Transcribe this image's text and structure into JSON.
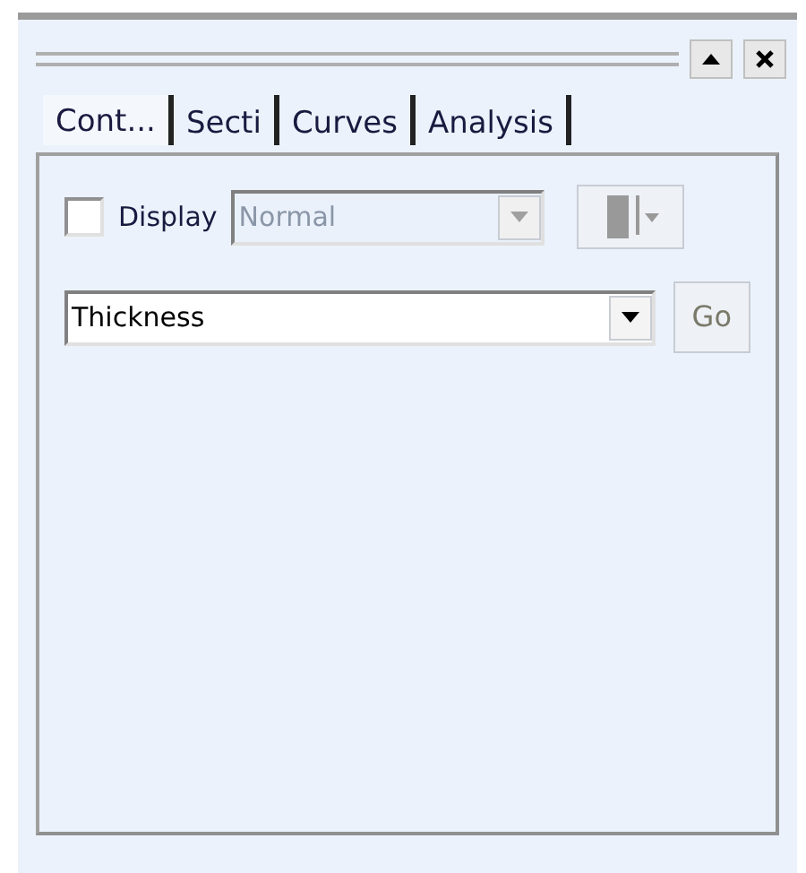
{
  "tabs": [
    {
      "label": "Cont...",
      "selected": true
    },
    {
      "label": "Secti",
      "selected": false
    },
    {
      "label": "Curves",
      "selected": false
    },
    {
      "label": "Analysis",
      "selected": false
    }
  ],
  "display": {
    "label": "Display",
    "checked": false
  },
  "mode_combo": {
    "value": "Normal",
    "disabled": true
  },
  "quantity_combo": {
    "value": "Thickness",
    "disabled": false
  },
  "go_button": {
    "label": "Go"
  }
}
